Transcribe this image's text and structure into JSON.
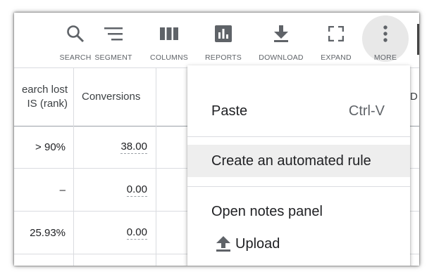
{
  "toolbar": {
    "search": "SEARCH",
    "segment": "SEGMENT",
    "columns": "COLUMNS",
    "reports": "REPORTS",
    "download": "DOWNLOAD",
    "expand": "EXPAND",
    "more": "MORE"
  },
  "table": {
    "headers": [
      "earch lost\nIS (rank)",
      "Conversions",
      "",
      "D"
    ],
    "rows": [
      {
        "lost_is": "> 90%",
        "conversions": "38.00"
      },
      {
        "lost_is": "–",
        "conversions": "0.00"
      },
      {
        "lost_is": "25.93%",
        "conversions": "0.00"
      }
    ]
  },
  "menu": {
    "paste": "Paste",
    "paste_shortcut": "Ctrl-V",
    "create_rule": "Create an automated rule",
    "open_notes": "Open notes panel",
    "upload": "Upload"
  },
  "colors": {
    "icon": "#5f6368",
    "highlight": "#eeeeee",
    "divider": "#dadce0"
  }
}
